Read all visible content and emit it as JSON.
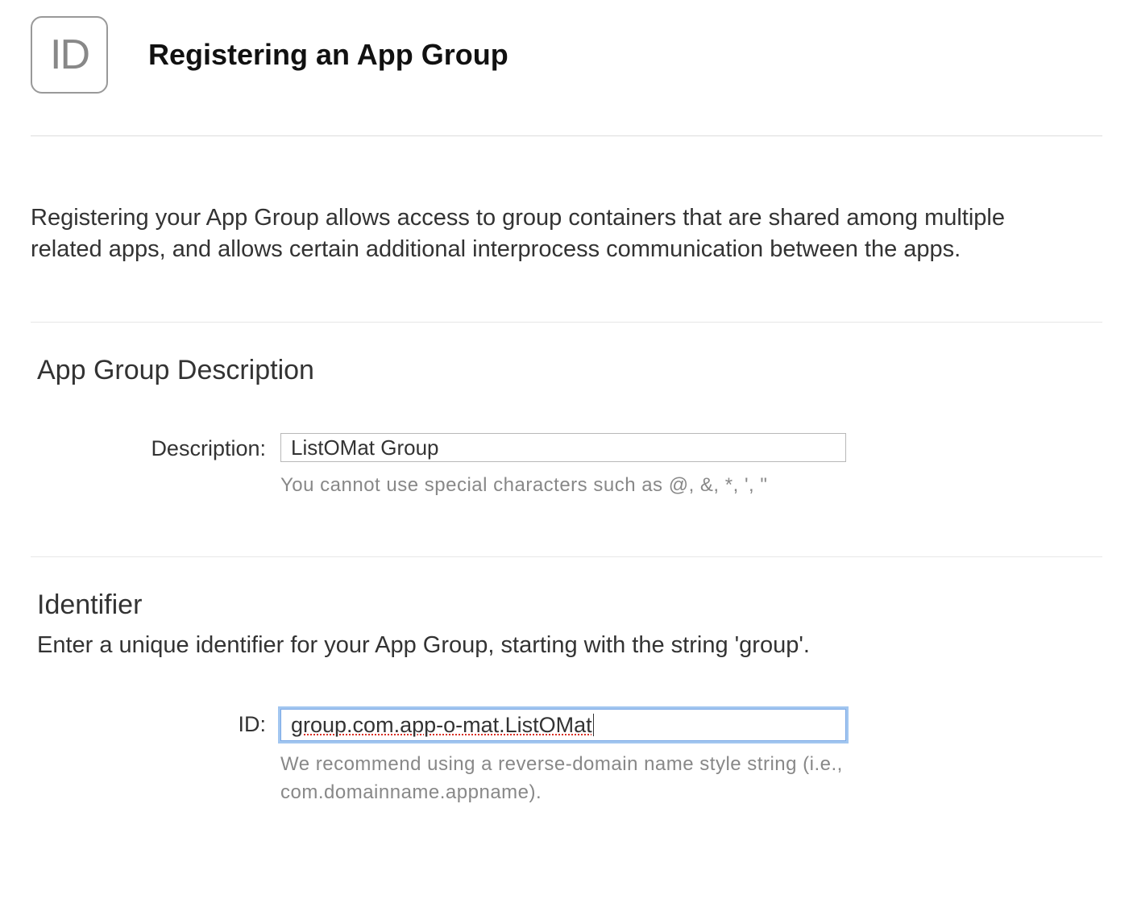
{
  "header": {
    "icon_label": "ID",
    "title": "Registering an App Group"
  },
  "intro": "Registering your App Group allows access to group containers that are shared among multiple related apps, and allows certain additional interprocess communication between the apps.",
  "sections": {
    "description": {
      "heading": "App Group Description",
      "field_label": "Description:",
      "value": "ListOMat Group",
      "hint": "You cannot use special characters such as @, &, *, ', \""
    },
    "identifier": {
      "heading": "Identifier",
      "subtext": "Enter a unique identifier for your App Group, starting with the string 'group'.",
      "field_label": "ID:",
      "value": "group.com.app-o-mat.ListOMat",
      "hint": "We recommend using a reverse-domain name style string (i.e., com.domainname.appname)."
    }
  }
}
